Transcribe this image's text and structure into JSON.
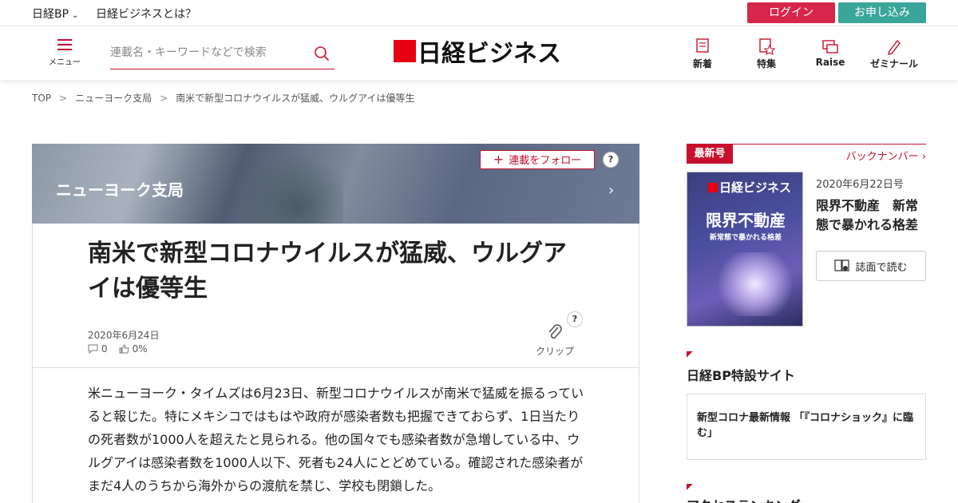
{
  "topbar": {
    "bp_label": "日経BP",
    "about_label": "日経ビジネスとは？",
    "login_label": "ログイン",
    "apply_label": "お申し込み"
  },
  "header": {
    "menu_label": "メニュー",
    "search_placeholder": "連載名・キーワードなどで検索",
    "logo_text": "日経ビジネス",
    "nav": [
      {
        "label": "新着",
        "icon": "new-icon"
      },
      {
        "label": "特集",
        "icon": "feature-icon"
      },
      {
        "label": "Raise",
        "icon": "raise-icon"
      },
      {
        "label": "ゼミナール",
        "icon": "seminar-icon"
      }
    ]
  },
  "breadcrumb": {
    "items": [
      "TOP",
      "ニューヨーク支局",
      "南米で新型コロナウイルスが猛威、ウルグアイは優等生"
    ],
    "separator": ">"
  },
  "article": {
    "series_title": "ニューヨーク支局",
    "follow_label": "連載をフォロー",
    "help_label": "?",
    "headline": "南米で新型コロナウイルスが猛威、ウルグアイは優等生",
    "date": "2020年6月24日",
    "comments": "0",
    "likes": "0%",
    "clip_label": "クリップ",
    "body": "米ニューヨーク・タイムズは6月23日、新型コロナウイルスが南米で猛威を振るっていると報じた。特にメキシコではもはや政府が感染者数も把握できておらず、1日当たりの死者数が1000人を超えたと見られる。他の国々でも感染者数が急増している中、ウルグアイは感染者数を1000人以下、死者も24人にとどめている。確認された感染者がまだ4人のうちから海外からの渡航を禁じ、学校も閉鎖した。"
  },
  "sidebar": {
    "latest_tag": "最新号",
    "back_numbers": "バックナンバー",
    "cover": {
      "logo": "日経ビジネス",
      "title": "限界不動産",
      "subtitle": "新常態で暴かれる格差"
    },
    "issue_date": "2020年6月22日号",
    "issue_title": "限界不動産　新常態で暴かれる格差",
    "read_label": "誌面で読む",
    "special_heading": "日経BP特設サイト",
    "special_item": "新型コロナ最新情報 「『コロナショック』に臨む」",
    "ranking_heading": "アクセスランキング"
  },
  "colors": {
    "brand_red": "#c8102e",
    "apply_green": "#3aa69a"
  }
}
